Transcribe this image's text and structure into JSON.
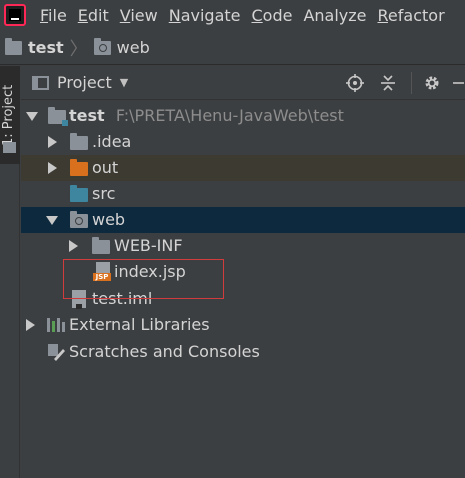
{
  "menubar": {
    "items": [
      {
        "mnemonic": "F",
        "rest": "ile"
      },
      {
        "mnemonic": "E",
        "rest": "dit"
      },
      {
        "mnemonic": "V",
        "rest": "iew"
      },
      {
        "mnemonic": "N",
        "rest": "avigate"
      },
      {
        "mnemonic": "C",
        "rest": "ode"
      },
      {
        "mnemonic": "",
        "rest": "Analyze"
      },
      {
        "mnemonic": "R",
        "rest": "efactor"
      }
    ]
  },
  "breadcrumb": {
    "items": [
      "test",
      "web"
    ]
  },
  "toolstrip": {
    "tab_label": "1: Project"
  },
  "project_panel": {
    "title": "Project",
    "actions": [
      "target-icon",
      "collapse-icon",
      "gear-icon",
      "hide-icon"
    ]
  },
  "tree": {
    "root_name": "test",
    "root_path": "F:\\PRETA\\Henu-JavaWeb\\test",
    "idea": ".idea",
    "out": "out",
    "src": "src",
    "web": "web",
    "webinf": "WEB-INF",
    "index": "index.jsp",
    "iml": "test.iml",
    "external": "External Libraries",
    "scratches": "Scratches and Consoles",
    "jsp_tag": "JSP"
  },
  "colors": {
    "background": "#3c3f41",
    "selection": "#0d293e",
    "highlight_box": "#d03b3b",
    "orange_folder": "#d8701d",
    "blue_folder": "#3e86a0"
  }
}
